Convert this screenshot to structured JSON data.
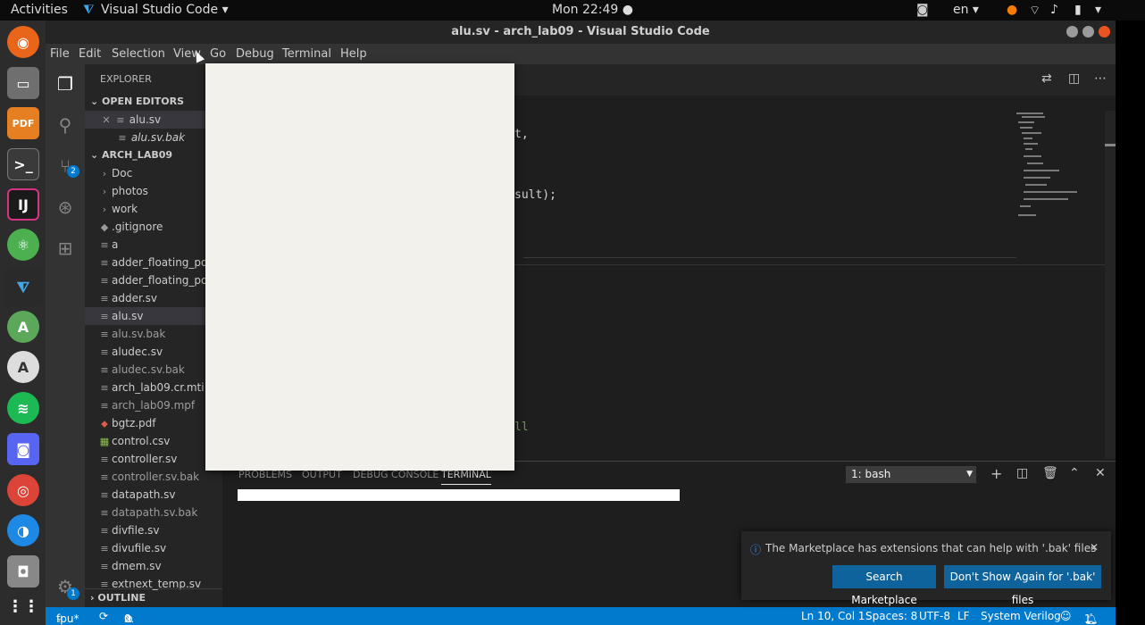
{
  "topbar": {
    "activities": "Activities",
    "app": "Visual Studio Code ▾",
    "clock": "Mon 22:49 ●",
    "lang": "en ▾"
  },
  "window": {
    "title": "alu.sv - arch_lab09 - Visual Studio Code"
  },
  "menu": [
    "File",
    "Edit",
    "Selection",
    "View",
    "Go",
    "Debug",
    "Terminal",
    "Help"
  ],
  "sidebar": {
    "title": "EXPLORER",
    "open_editors": "OPEN EDITORS",
    "open_files": [
      "alu.sv",
      "alu.sv.bak"
    ],
    "folder": "ARCH_LAB09",
    "items": [
      {
        "label": "Doc",
        "icon": "›"
      },
      {
        "label": "photos",
        "icon": "›"
      },
      {
        "label": "work",
        "icon": "›"
      },
      {
        "label": ".gitignore",
        "icon": "◆"
      },
      {
        "label": "a",
        "icon": "≡"
      },
      {
        "label": "adder_floating_poi",
        "icon": "≡"
      },
      {
        "label": "adder_floating_poi",
        "icon": "≡"
      },
      {
        "label": "adder.sv",
        "icon": "≡"
      },
      {
        "label": "alu.sv",
        "icon": "≡"
      },
      {
        "label": "alu.sv.bak",
        "icon": "≡"
      },
      {
        "label": "aludec.sv",
        "icon": "≡"
      },
      {
        "label": "aludec.sv.bak",
        "icon": "≡"
      },
      {
        "label": "arch_lab09.cr.mti",
        "icon": "≡"
      },
      {
        "label": "arch_lab09.mpf",
        "icon": "≡"
      },
      {
        "label": "bgtz.pdf",
        "icon": "⬥"
      },
      {
        "label": "control.csv",
        "icon": "▦"
      },
      {
        "label": "controller.sv",
        "icon": "≡"
      },
      {
        "label": "controller.sv.bak",
        "icon": "≡"
      },
      {
        "label": "datapath.sv",
        "icon": "≡"
      },
      {
        "label": "datapath.sv.bak",
        "icon": "≡"
      },
      {
        "label": "divfile.sv",
        "icon": "≡"
      },
      {
        "label": "divufile.sv",
        "icon": "≡"
      },
      {
        "label": "dmem.sv",
        "icon": "≡"
      },
      {
        "label": "extnext_temp.sv",
        "icon": "≡"
      }
    ],
    "outline": "OUTLINE"
  },
  "editor": {
    "lines": [
      "t,",
      "sult);",
      "ll"
    ]
  },
  "panel": {
    "tabs": [
      "PROBLEMS",
      "OUTPUT",
      "DEBUG CONSOLE",
      "TERMINAL"
    ],
    "terminal_select": "1: bash"
  },
  "notification": {
    "message": "The Marketplace has extensions that can help with '.bak' files",
    "btn_search": "Search Marketplace",
    "btn_dont": "Don't Show Again for '.bak' files"
  },
  "status": {
    "branch": "fpu*",
    "errors": "0",
    "warnings": "0",
    "position": "Ln 10, Col 1",
    "spaces": "Spaces: 8",
    "encoding": "UTF-8",
    "eol": "LF",
    "language": "System Verilog",
    "bell": "1"
  },
  "badges": {
    "scm": "2",
    "settings": "1"
  }
}
